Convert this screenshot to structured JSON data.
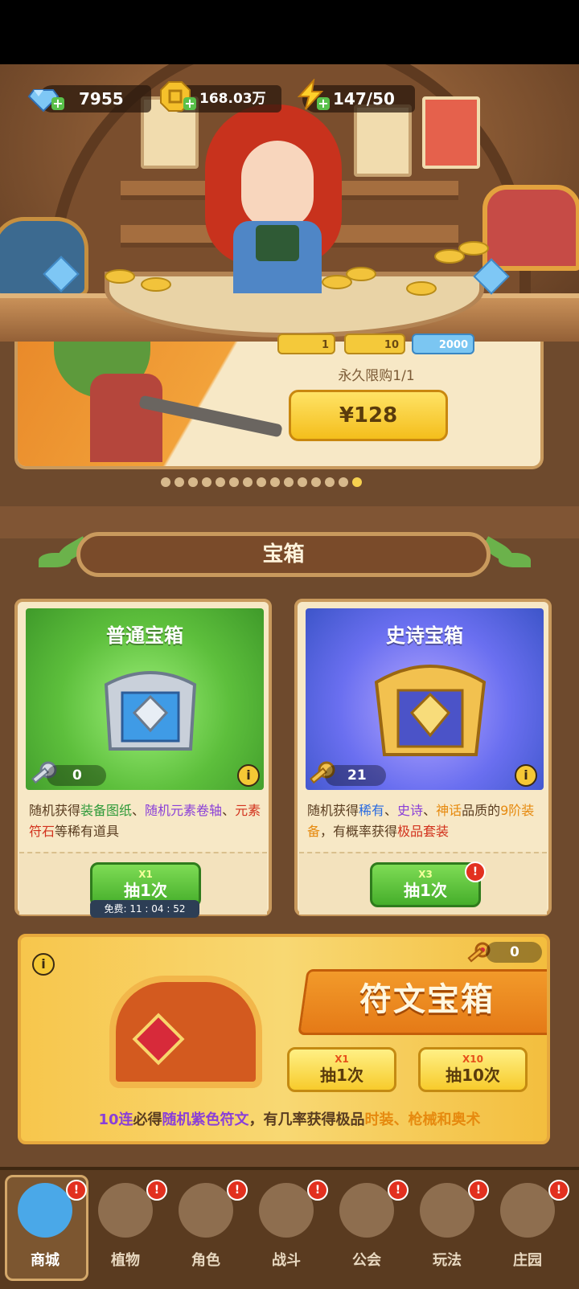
{
  "currencies": {
    "gems": "7955",
    "gold": "168.03万",
    "energy": "147/50"
  },
  "promo": {
    "token_values": [
      "1",
      "10",
      "2000"
    ],
    "limit_text": "永久限购1/1",
    "price": "¥128",
    "dots_total": 15,
    "dots_active_index": 14
  },
  "section_title": "宝箱",
  "normal_chest": {
    "title": "普通宝箱",
    "key_count": "0",
    "desc_parts": [
      {
        "t": "随机获得",
        "c": ""
      },
      {
        "t": "装备图纸",
        "c": "g"
      },
      {
        "t": "、",
        "c": ""
      },
      {
        "t": "随机元素卷轴",
        "c": "p"
      },
      {
        "t": "、",
        "c": ""
      },
      {
        "t": "元素符石",
        "c": "r"
      },
      {
        "t": "等稀有道具",
        "c": ""
      }
    ],
    "button_cost": "X1",
    "button_label": "抽1次",
    "timer": "免费: 11 : 04 : 52"
  },
  "epic_chest": {
    "title": "史诗宝箱",
    "key_count": "21",
    "desc_parts": [
      {
        "t": "随机获得",
        "c": ""
      },
      {
        "t": "稀有",
        "c": "b"
      },
      {
        "t": "、",
        "c": ""
      },
      {
        "t": "史诗",
        "c": "p"
      },
      {
        "t": "、",
        "c": ""
      },
      {
        "t": "神话",
        "c": "o"
      },
      {
        "t": "品质的",
        "c": ""
      },
      {
        "t": "9阶装备",
        "c": "o"
      },
      {
        "t": "，有概率获得",
        "c": ""
      },
      {
        "t": "极品套装",
        "c": "r"
      }
    ],
    "button_cost": "X3",
    "button_label": "抽1次"
  },
  "rune_chest": {
    "title": "符文宝箱",
    "key_count": "0",
    "btn1_cost": "X1",
    "btn1_label": "抽1次",
    "btn10_cost": "X10",
    "btn10_label": "抽10次",
    "desc_parts": [
      {
        "t": "10连",
        "c": "p"
      },
      {
        "t": "必得",
        "c": ""
      },
      {
        "t": "随机紫色符文",
        "c": "p"
      },
      {
        "t": "，有几率获得极品",
        "c": ""
      },
      {
        "t": "时装、枪械和奥术",
        "c": "o"
      }
    ]
  },
  "badge_text": "!",
  "info_text": "i",
  "nav": [
    {
      "label": "商城",
      "icon": "shop-icon"
    },
    {
      "label": "植物",
      "icon": "plant-icon"
    },
    {
      "label": "角色",
      "icon": "character-icon"
    },
    {
      "label": "战斗",
      "icon": "battle-icon"
    },
    {
      "label": "公会",
      "icon": "guild-icon"
    },
    {
      "label": "玩法",
      "icon": "gameplay-icon"
    },
    {
      "label": "庄园",
      "icon": "manor-icon"
    }
  ],
  "colors": {
    "accent_green": "#46ae2b",
    "accent_yellow": "#f7cb2c",
    "badge_red": "#e2301f",
    "wood_brown": "#6e4a2d"
  }
}
